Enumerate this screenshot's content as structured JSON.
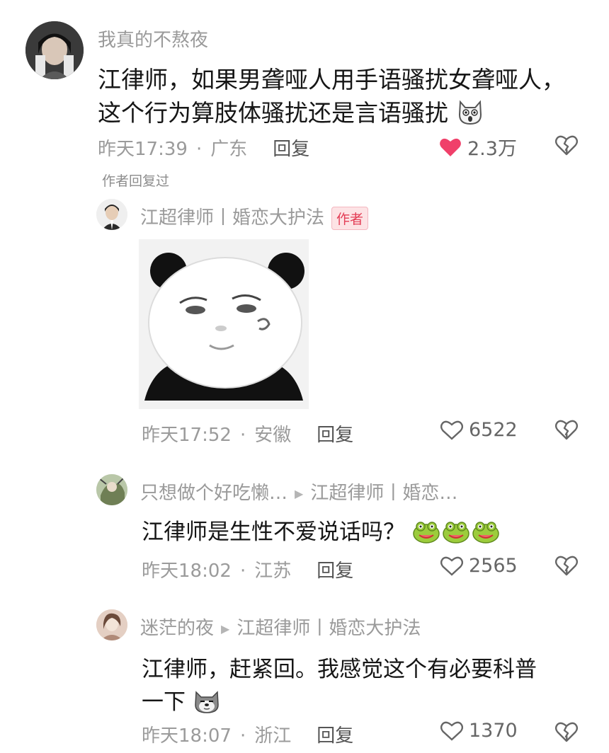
{
  "comments": [
    {
      "username": "我真的不熬夜",
      "text_line1": "江律师，如果男聋哑人用手语骚扰女聋哑人，",
      "text_line2": "这个行为算肢体骚扰还是言语骚扰",
      "time": "昨天17:39",
      "location": "广东",
      "reply_label": "回复",
      "likes": "2.3万",
      "liked": true,
      "author_replied": "作者回复过"
    },
    {
      "username": "江超律师丨婚恋大护法",
      "author_badge": "作者",
      "time": "昨天17:52",
      "location": "安徽",
      "reply_label": "回复",
      "likes": "6522"
    },
    {
      "username": "只想做个好吃懒…",
      "reply_to": "江超律师丨婚恋…",
      "text_line1": "江律师是生性不爱说话吗？",
      "time": "昨天18:02",
      "location": "江苏",
      "reply_label": "回复",
      "likes": "2565"
    },
    {
      "username": "迷茫的夜",
      "reply_to": "江超律师丨婚恋大护法",
      "text_line1": "江律师，赶紧回。我感觉这个有必要科普",
      "text_line2": "一下",
      "time": "昨天18:07",
      "location": "浙江",
      "reply_label": "回复",
      "likes": "1370"
    }
  ],
  "separator_dot": "·",
  "icons": {
    "like": "heart-icon",
    "dislike": "broken-heart-icon",
    "emoji_shock": "shocked-cat-emoji",
    "emoji_frog": "frog-emoji",
    "emoji_dog": "dog-emoji",
    "sticker": "panda-meme-sticker"
  },
  "colors": {
    "liked_heart": "#f0406a",
    "badge_bg": "#fde3e5",
    "badge_text": "#e33d55"
  }
}
